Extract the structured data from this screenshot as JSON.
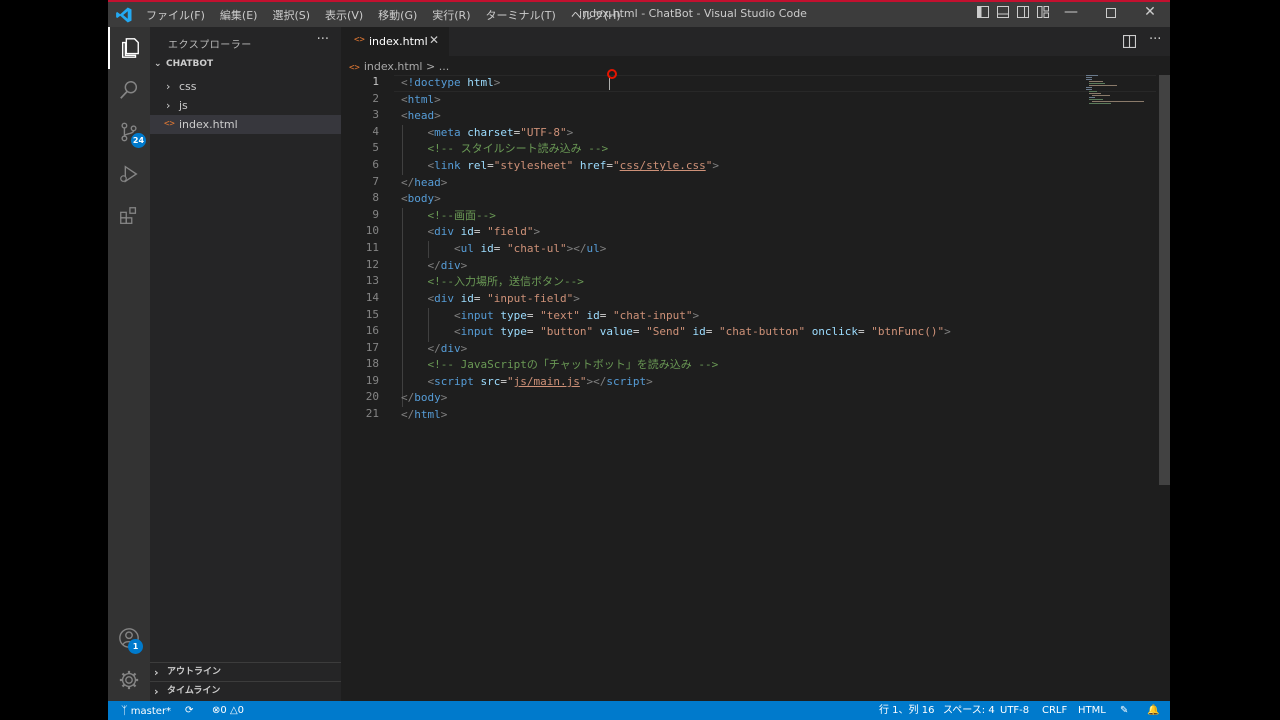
{
  "titlebar": {
    "menu": [
      "ファイル(F)",
      "編集(E)",
      "選択(S)",
      "表示(V)",
      "移動(G)",
      "実行(R)",
      "ターミナル(T)",
      "ヘルプ(H)"
    ],
    "title": "index.html - ChatBot - Visual Studio Code",
    "accent": "#c3102f"
  },
  "activity": {
    "source_control_badge": "24",
    "accounts_badge": "1"
  },
  "sidebar": {
    "title": "エクスプローラー",
    "more": "···",
    "project": "CHATBOT",
    "items": [
      {
        "label": "css",
        "type": "folder"
      },
      {
        "label": "js",
        "type": "folder"
      },
      {
        "label": "index.html",
        "type": "file"
      }
    ],
    "sections": [
      "アウトライン",
      "タイムライン"
    ]
  },
  "editor": {
    "tab_label": "index.html",
    "breadcrumb": "index.html > ...",
    "line_numbers": [
      "1",
      "2",
      "3",
      "4",
      "5",
      "6",
      "7",
      "8",
      "9",
      "10",
      "11",
      "12",
      "13",
      "14",
      "15",
      "16",
      "17",
      "18",
      "19",
      "20",
      "21"
    ]
  },
  "status": {
    "branch": "master*",
    "errors": "0",
    "warnings": "0",
    "position": "行 1、列 16",
    "spaces": "スペース: 4",
    "encoding": "UTF-8",
    "eol": "CRLF",
    "language": "HTML"
  }
}
